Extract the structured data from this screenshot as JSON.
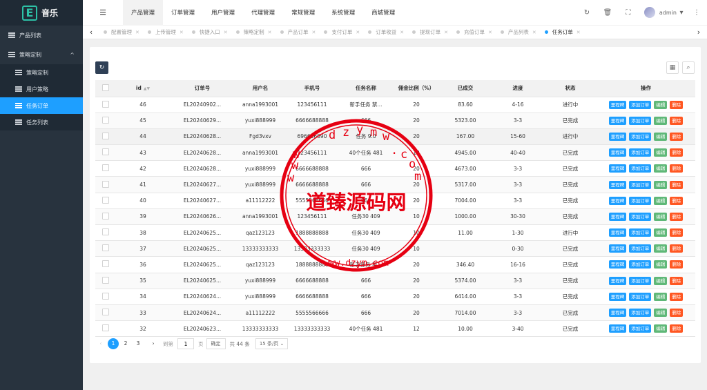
{
  "sidebar": {
    "logo_letter": "E",
    "logo_text": "音乐",
    "items": [
      {
        "label": "产品列表"
      },
      {
        "label": "策略定制",
        "caret": "^"
      }
    ],
    "subitems": [
      {
        "label": "策略定制"
      },
      {
        "label": "用户策略"
      },
      {
        "label": "任务订单",
        "active": true
      },
      {
        "label": "任务列表"
      }
    ]
  },
  "header": {
    "menu_toggle": "☰",
    "nav": [
      "产品管理",
      "订单管理",
      "用户管理",
      "代理管理",
      "常规管理",
      "系统管理",
      "商城管理"
    ],
    "active_nav": 0,
    "refresh_icon": "↻",
    "trash_icon": "🗑",
    "fullscreen_icon": "⛶",
    "username": "admin",
    "dropdown": "▾",
    "more_icon": "⋮"
  },
  "tabs": {
    "prev": "‹",
    "next": "›",
    "items": [
      "配置管理",
      "上传管理",
      "快捷入口",
      "策略定制",
      "产品订单",
      "支付订单",
      "订单收益",
      "提现订单",
      "充值订单",
      "产品列表",
      "任务订单"
    ],
    "active": 10
  },
  "toolbar": {
    "refresh": "↻",
    "grid": "▦",
    "search": "⌕"
  },
  "table": {
    "columns": [
      "id",
      "订单号",
      "用户名",
      "手机号",
      "任务名称",
      "佣金比例（%）",
      "已成交",
      "进度",
      "状态",
      "操作"
    ],
    "sort_icon": "▲▼",
    "rows": [
      [
        "46",
        "EL20240902...",
        "anna1993001",
        "123456111",
        "新手任务 禁...",
        "20",
        "83.60",
        "4-16",
        "进行中"
      ],
      [
        "45",
        "EL20240629...",
        "yuxi888999",
        "6666688888",
        "666",
        "20",
        "5323.00",
        "3-3",
        "已完成"
      ],
      [
        "44",
        "EL20240628...",
        "Fgd3vxv",
        "696666090",
        "任务 9.0",
        "20",
        "167.00",
        "15-60",
        "进行中"
      ],
      [
        "43",
        "EL20240628...",
        "anna1993001",
        "123456111",
        "40个任务 481",
        "12",
        "4945.00",
        "40-40",
        "已完成"
      ],
      [
        "42",
        "EL20240628...",
        "yuxi888999",
        "6666688888",
        "666",
        "20",
        "4673.00",
        "3-3",
        "已完成"
      ],
      [
        "41",
        "EL20240627...",
        "yuxi888999",
        "6666688888",
        "666",
        "20",
        "5317.00",
        "3-3",
        "已完成"
      ],
      [
        "40",
        "EL20240627...",
        "a11112222",
        "5555566666",
        "666",
        "20",
        "7004.00",
        "3-3",
        "已完成"
      ],
      [
        "39",
        "EL20240626...",
        "anna1993001",
        "123456111",
        "任务30 409",
        "10",
        "1000.00",
        "30-30",
        "已完成"
      ],
      [
        "38",
        "EL20240625...",
        "qaz123123",
        "1888888888",
        "任务30 409",
        "10",
        "11.00",
        "1-30",
        "进行中"
      ],
      [
        "37",
        "EL20240625...",
        "13333333333",
        "13333333333",
        "任务30 409",
        "10",
        "",
        "0-30",
        "已完成"
      ],
      [
        "36",
        "EL20240625...",
        "qaz123123",
        "1888888888",
        "新手任务 禁...",
        "20",
        "346.40",
        "16-16",
        "已完成"
      ],
      [
        "35",
        "EL20240625...",
        "yuxi888999",
        "6666688888",
        "666",
        "20",
        "5374.00",
        "3-3",
        "已完成"
      ],
      [
        "34",
        "EL20240624...",
        "yuxi888999",
        "6666688888",
        "666",
        "20",
        "6414.00",
        "3-3",
        "已完成"
      ],
      [
        "33",
        "EL20240624...",
        "a11112222",
        "5555566666",
        "666",
        "20",
        "7014.00",
        "3-3",
        "已完成"
      ],
      [
        "32",
        "EL20240623...",
        "13333333333",
        "13333333333",
        "40个任务 481",
        "12",
        "10.00",
        "3-40",
        "已完成"
      ]
    ],
    "ops": [
      "里程碑",
      "添加订单",
      "编辑",
      "删除"
    ]
  },
  "pager": {
    "prev": "‹",
    "pages": [
      "1",
      "2",
      "3"
    ],
    "current": 0,
    "next": "›",
    "goto": "到第",
    "input_value": "1",
    "page_unit": "页",
    "ok": "确定",
    "total": "共 44 条",
    "size": "15 条/页",
    "size_caret": "⌄"
  },
  "watermark": {
    "text": "道臻源码网",
    "top_letters": [
      "d",
      "z",
      "y",
      "m",
      "w",
      ".",
      "c",
      "o",
      "m"
    ],
    "side_letters_left": [
      "w",
      "w",
      "w"
    ],
    "bottom_text": "www.dzym.com",
    "color": "#e60012"
  }
}
